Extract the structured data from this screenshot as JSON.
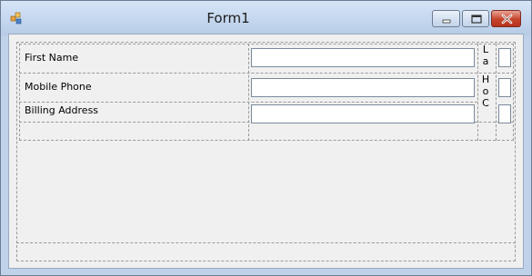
{
  "window": {
    "title": "Form1",
    "icon": "windows-forms-app-icon",
    "controls": {
      "minimize_icon": "minimize-icon",
      "maximize_icon": "maximize-icon",
      "close_icon": "close-icon"
    }
  },
  "form": {
    "fields": [
      {
        "label": "First Name",
        "value": ""
      },
      {
        "label": "Mobile Phone",
        "value": ""
      },
      {
        "label": "Billing Address",
        "value": ""
      }
    ],
    "side_label_1": [
      "L",
      "a"
    ],
    "side_label_2": [
      "H",
      "o",
      "C"
    ]
  },
  "colors": {
    "close_button": "#c6442c",
    "titlebar": "#c4d7ee",
    "client_background": "#f0f0f0"
  }
}
